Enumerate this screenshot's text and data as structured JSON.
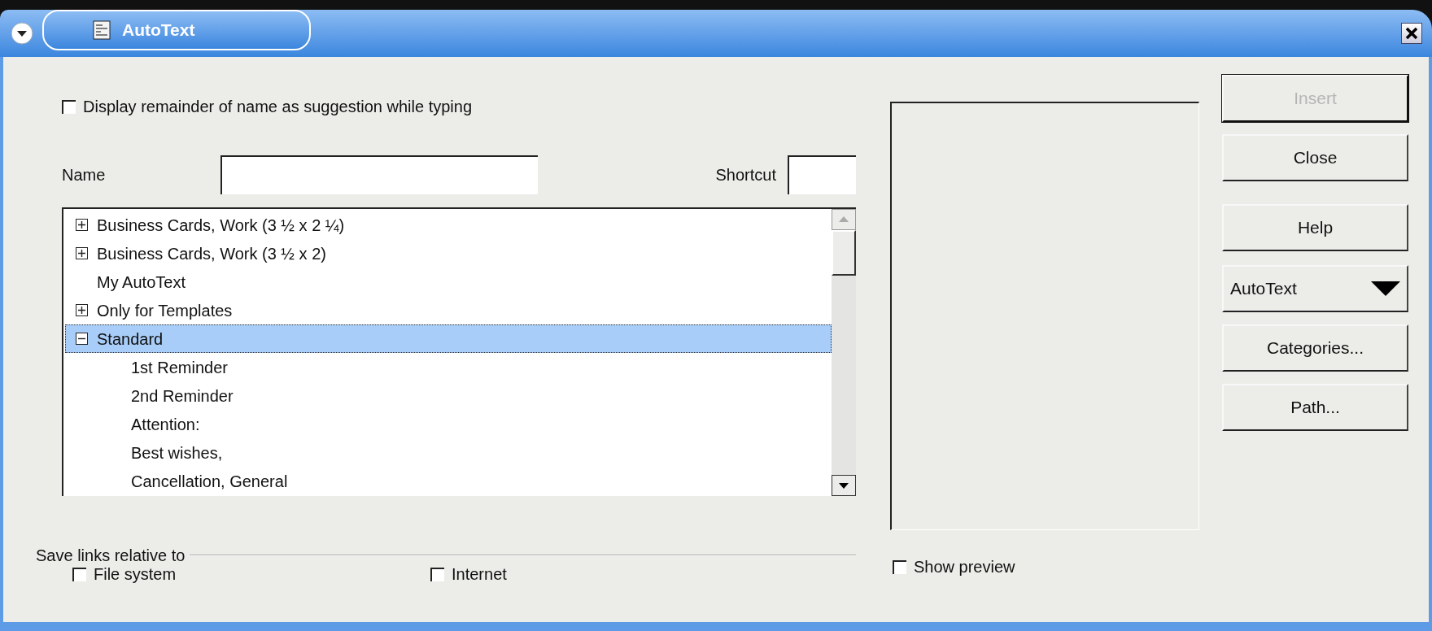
{
  "window": {
    "title": "AutoText"
  },
  "suggestion_checkbox": {
    "label": "Display remainder of name as suggestion while typing",
    "checked": false
  },
  "name_field": {
    "label": "Name"
  },
  "shortcut_field": {
    "label": "Shortcut"
  },
  "tree": [
    {
      "label": "Business Cards, Work (3 ½ x 2 ¼)",
      "kind": "folder",
      "expanded": false,
      "selected": false
    },
    {
      "label": "Business Cards, Work (3 ½ x 2)",
      "kind": "folder",
      "expanded": false,
      "selected": false
    },
    {
      "label": "My AutoText",
      "kind": "leaf",
      "selected": false
    },
    {
      "label": "Only for Templates",
      "kind": "folder",
      "expanded": false,
      "selected": false
    },
    {
      "label": "Standard",
      "kind": "folder",
      "expanded": true,
      "selected": true,
      "children": [
        {
          "label": "1st Reminder",
          "kind": "leaf",
          "selected": false
        },
        {
          "label": "2nd Reminder",
          "kind": "leaf",
          "selected": false
        },
        {
          "label": "Attention:",
          "kind": "leaf",
          "selected": false
        },
        {
          "label": "Best wishes,",
          "kind": "leaf",
          "selected": false
        },
        {
          "label": "Cancellation, General",
          "kind": "leaf",
          "selected": false
        }
      ]
    }
  ],
  "save_links": {
    "label": "Save links relative to",
    "options": [
      {
        "label": "File system",
        "checked": false
      },
      {
        "label": "Internet",
        "checked": false
      }
    ]
  },
  "show_preview": {
    "label": "Show preview",
    "checked": false
  },
  "buttons": [
    {
      "label": "Insert",
      "kind": "push",
      "disabled": true,
      "default": true
    },
    {
      "label": "Close",
      "kind": "push",
      "disabled": false,
      "default": false
    },
    {
      "label": "Help",
      "kind": "push",
      "disabled": false,
      "default": false
    },
    {
      "label": "AutoText",
      "kind": "menu",
      "disabled": false,
      "default": false
    },
    {
      "label": "Categories...",
      "kind": "push",
      "disabled": false,
      "default": false
    },
    {
      "label": "Path...",
      "kind": "push",
      "disabled": false,
      "default": false
    }
  ]
}
